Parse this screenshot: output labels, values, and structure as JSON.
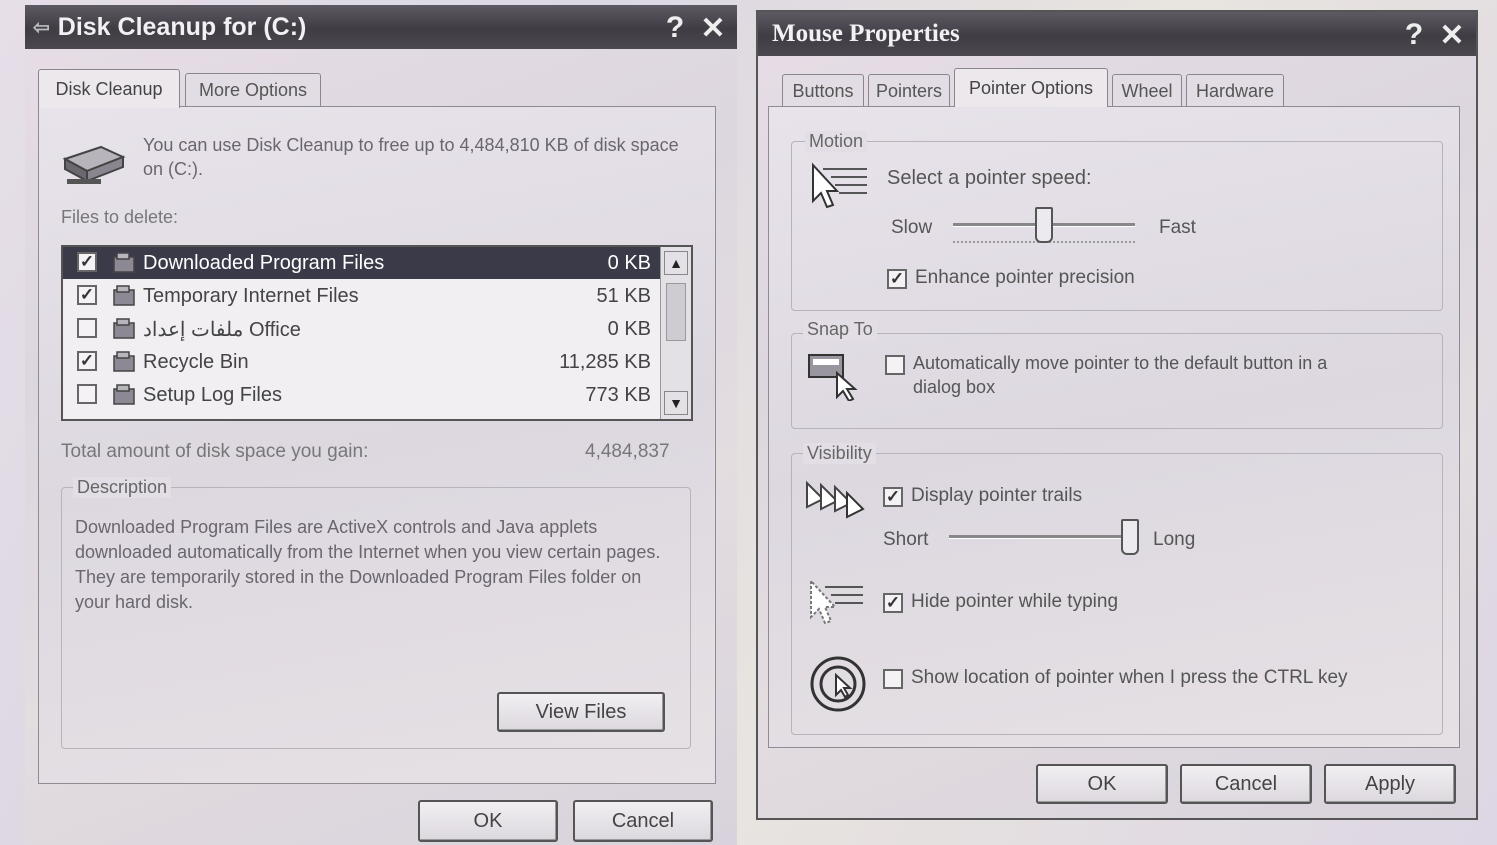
{
  "disk_cleanup": {
    "title": "Disk Cleanup for  (C:)",
    "help": "?",
    "close": "✕",
    "tabs": [
      "Disk Cleanup",
      "More Options"
    ],
    "intro": "You can use Disk Cleanup to free up to 4,484,810 KB of disk space on  (C:).",
    "files_label": "Files to delete:",
    "files": [
      {
        "name": "Downloaded Program Files",
        "size": "0 KB",
        "checked": true,
        "selected": true
      },
      {
        "name": "Temporary Internet Files",
        "size": "51 KB",
        "checked": true,
        "selected": false
      },
      {
        "name": "ملفات إعداد Office",
        "size": "0 KB",
        "checked": false,
        "selected": false
      },
      {
        "name": "Recycle Bin",
        "size": "11,285 KB",
        "checked": true,
        "selected": false
      },
      {
        "name": "Setup Log Files",
        "size": "773 KB",
        "checked": false,
        "selected": false
      }
    ],
    "total_label": "Total amount of disk space you gain:",
    "total_value": "4,484,837",
    "description_label": "Description",
    "description": "Downloaded Program Files are ActiveX controls and Java applets downloaded automatically from the Internet when you view certain pages. They are temporarily stored in the Downloaded Program Files folder on your hard disk.",
    "view_files": "View Files",
    "ok": "OK",
    "cancel": "Cancel"
  },
  "mouse_properties": {
    "title": "Mouse Properties",
    "help": "?",
    "close": "✕",
    "tabs": [
      "Buttons",
      "Pointers",
      "Pointer Options",
      "Wheel",
      "Hardware"
    ],
    "motion": {
      "label": "Motion",
      "prompt": "Select a pointer speed:",
      "slow": "Slow",
      "fast": "Fast",
      "speed_fraction": 0.5,
      "enhance_label": "Enhance pointer precision",
      "enhance_checked": true
    },
    "snap_to": {
      "label": "Snap To",
      "auto_label_1": "Automatically move pointer to the default button in a",
      "auto_label_2": "dialog box",
      "auto_checked": false
    },
    "visibility": {
      "label": "Visibility",
      "trails_label": "Display pointer trails",
      "trails_checked": true,
      "short": "Short",
      "long": "Long",
      "trail_fraction": 1.0,
      "hide_label": "Hide pointer while typing",
      "hide_checked": true,
      "ctrl_label": "Show location of pointer when I press the CTRL key",
      "ctrl_checked": false
    },
    "ok": "OK",
    "cancel": "Cancel",
    "apply": "Apply"
  }
}
